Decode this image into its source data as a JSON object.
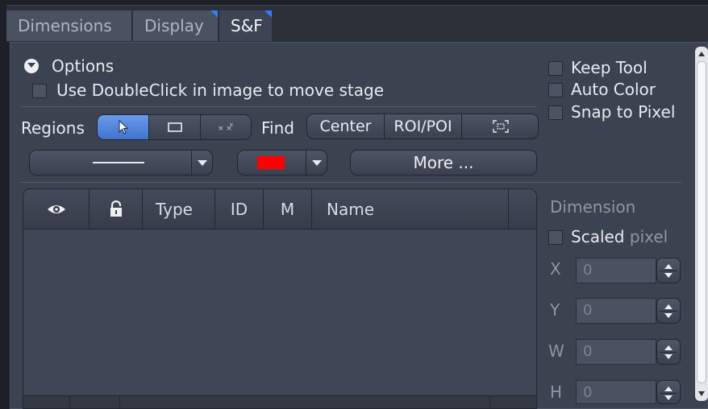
{
  "tabs": [
    {
      "label": "Dimensions",
      "active": false
    },
    {
      "label": "Display",
      "active": false
    },
    {
      "label": "S&F",
      "active": true
    }
  ],
  "options": {
    "header": "Options",
    "doubleclick_label": "Use DoubleClick in image to move stage"
  },
  "toggles": {
    "keep_tool": "Keep Tool",
    "auto_color": "Auto Color",
    "snap_to_pixel": "Snap to Pixel"
  },
  "regions": {
    "label": "Regions",
    "tools": [
      "pointer-icon",
      "rectangle-icon",
      "points-icon"
    ]
  },
  "find": {
    "label": "Find",
    "buttons": [
      "Center",
      "ROI/POI",
      "fit-selection-icon"
    ]
  },
  "line_style_combo": "line-style",
  "color_combo": {
    "color": "#ff0000"
  },
  "more_button": "More ...",
  "table": {
    "columns": [
      "eye-icon",
      "lock-icon",
      "Type",
      "ID",
      "M",
      "Name"
    ],
    "rows": []
  },
  "dimension": {
    "header": "Dimension",
    "scaled_label": "Scaled",
    "unit": "pixel",
    "fields": [
      {
        "label": "X",
        "value": "0"
      },
      {
        "label": "Y",
        "value": "0"
      },
      {
        "label": "W",
        "value": "0"
      },
      {
        "label": "H",
        "value": "0"
      }
    ]
  },
  "colors": {
    "accent": "#3f74cf",
    "panel": "#3b4250"
  }
}
